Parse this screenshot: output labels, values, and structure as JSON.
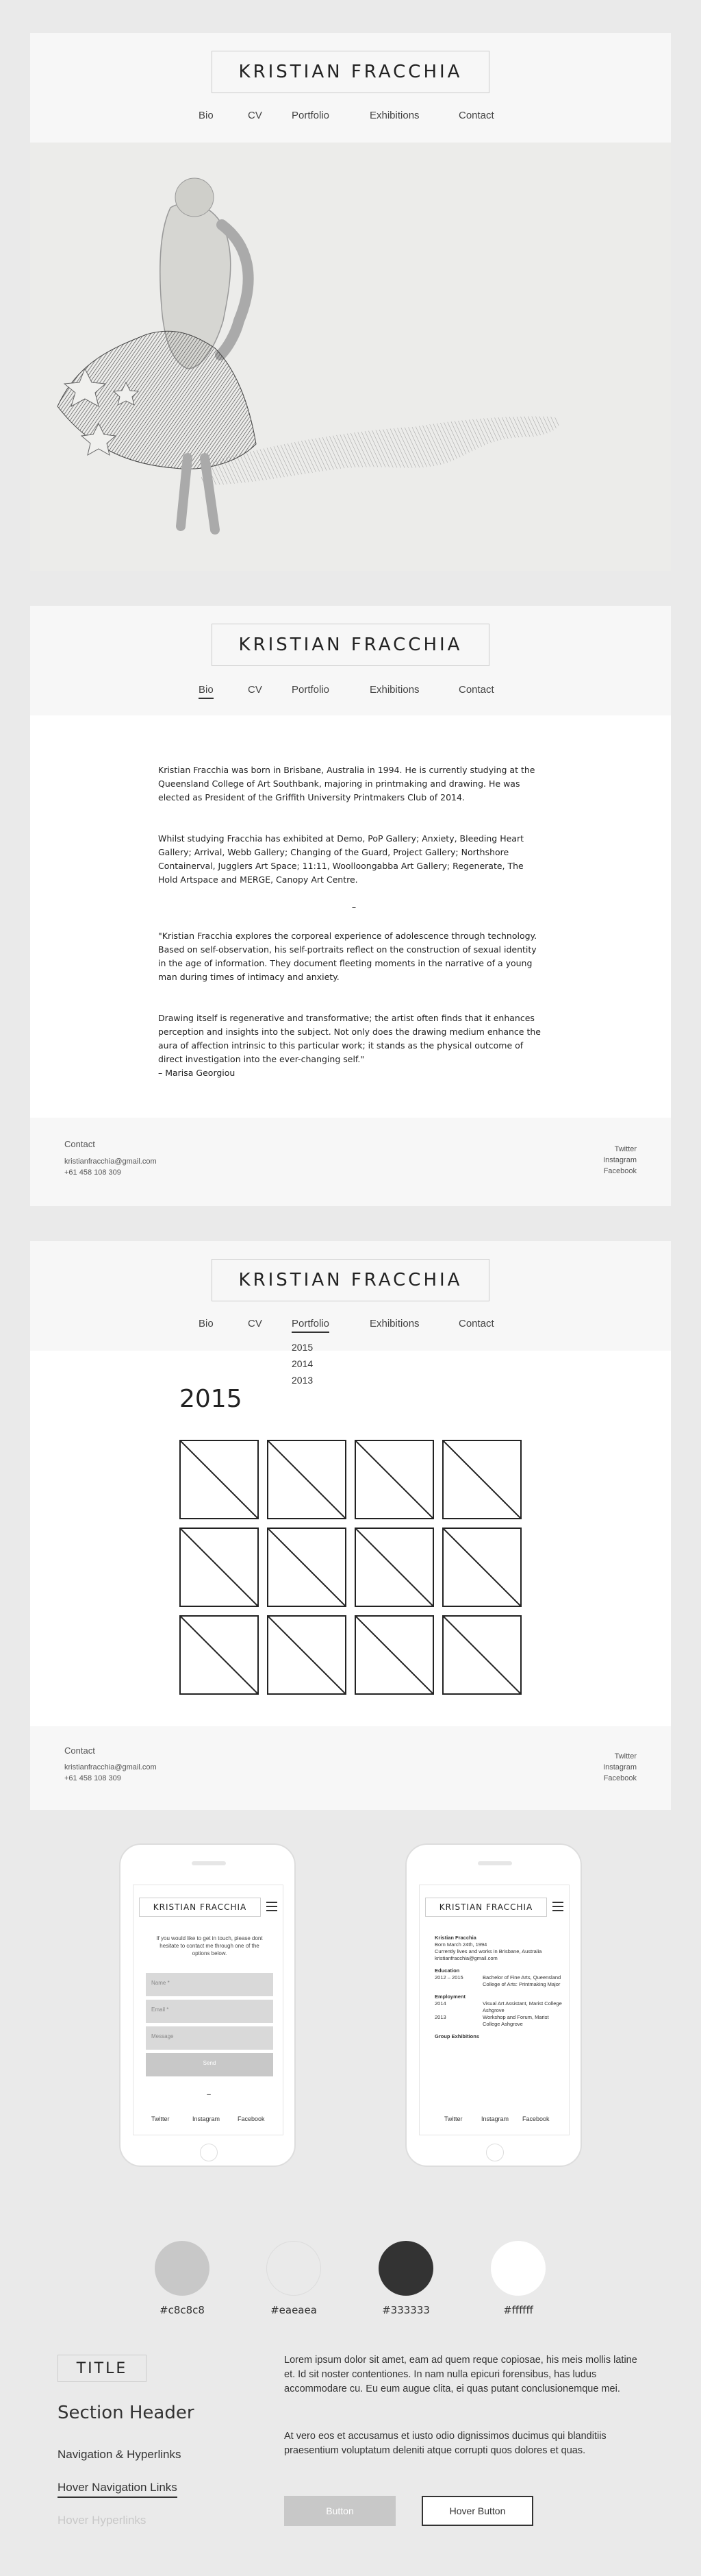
{
  "site": {
    "title": "KRISTIAN FRACCHIA"
  },
  "nav": [
    "Bio",
    "CV",
    "Portfolio",
    "Exhibitions",
    "Contact"
  ],
  "bio": {
    "p1": "Kristian Fracchia was born in Brisbane, Australia in 1994. He is currently studying at the Queensland College of Art Southbank, majoring in printmaking and drawing. He was elected as President of the Griffith University Printmakers Club of 2014.",
    "p2": "Whilst studying Fracchia has exhibited at Demo, PoP Gallery; Anxiety, Bleeding Heart Gallery; Arrival, Webb Gallery; Changing of the Guard, Project Gallery; Northshore Containerval, Jugglers Art Space; 11:11, Woolloongabba Art Gallery; Regenerate, The Hold Artspace and MERGE, Canopy Art Centre.",
    "divider": "–",
    "p3": "\"Kristian Fracchia explores the corporeal experience of adolescence through technology. Based on self-observation, his self-portraits reflect on the construction of sexual identity in the age of information. They document fleeting moments in the narrative of a young man during times of intimacy and anxiety.",
    "p4": "Drawing itself is regenerative and transformative; the artist often finds that it enhances perception and insights into the subject. Not only does the drawing medium enhance the aura of affection intrinsic to this particular work; it stands as the physical outcome of direct investigation into the ever-changing self.\"",
    "attribution": "– Marisa Georgiou"
  },
  "footer": {
    "contact_label": "Contact",
    "email": "kristianfracchia@gmail.com",
    "phone": "+61 458 108 309",
    "social": [
      "Twitter",
      "Instagram",
      "Facebook"
    ]
  },
  "portfolio": {
    "years": [
      "2015",
      "2014",
      "2013"
    ],
    "heading": "2015"
  },
  "mobile_contact": {
    "intro": "If you would like to get in touch, please dont hesitate to contact me through one of the options below.",
    "fields": [
      "Name *",
      "Email *",
      "Message"
    ],
    "send": "Send",
    "divider": "–",
    "social": [
      "Twitter",
      "Instagram",
      "Facebook"
    ]
  },
  "mobile_cv": {
    "name": "Kristian Fracchia",
    "born": "Born March 24th, 1994",
    "location": "Currently lives and works in Brisbane, Australia",
    "email": "kristianfracchia@gmail.com",
    "education_h": "Education",
    "edu_year": "2012 – 2015",
    "edu_text": "Bachelor of Fine Arts, Queensland College of Arts: Printmaking Major",
    "employment_h": "Employment",
    "emp1_year": "2014",
    "emp1_text": "Visual Art Assistant, Marist College Ashgrove",
    "emp2_year": "2013",
    "emp2_text": "Workshop and Forum, Marist College Ashgrove",
    "group_h": "Group Exhibitions",
    "social": [
      "Twitter",
      "Instagram",
      "Facebook"
    ]
  },
  "palette": [
    {
      "hex": "#c8c8c8",
      "label": "#c8c8c8"
    },
    {
      "hex": "#eaeaea",
      "label": "#eaeaea"
    },
    {
      "hex": "#333333",
      "label": "#333333"
    },
    {
      "hex": "#ffffff",
      "label": "#ffffff"
    }
  ],
  "styleguide": {
    "title": "TITLE",
    "section_header": "Section Header",
    "nav_links": "Navigation & Hyperlinks",
    "hover_nav": "Hover Navigation Links",
    "hover_links": "Hover Hyperlinks",
    "body1": "Lorem ipsum dolor sit amet, eam ad quem reque copiosae, his meis mollis latine et. Id sit noster contentiones. In nam nulla epicuri forensibus, has ludus accommodare cu. Eu eum augue clita, ei quas putant conclusionemque mei.",
    "body2": "At vero eos et accusamus et iusto odio dignissimos ducimus qui blanditiis praesentium voluptatum deleniti atque corrupti quos dolores et quas.",
    "button": "Button",
    "hover_button": "Hover Button"
  },
  "colors": {
    "bg": "#eaeaea",
    "header": "#f7f7f7",
    "text": "#333333",
    "accent": "#c8c8c8"
  }
}
